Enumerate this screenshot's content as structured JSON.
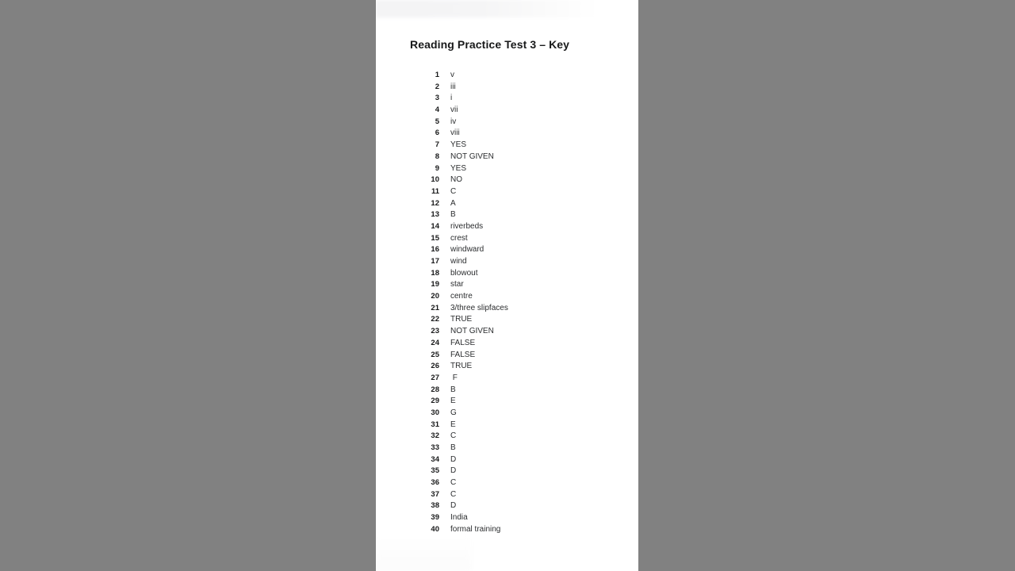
{
  "background": {
    "color": "#818181"
  },
  "document": {
    "page_background": "#ffffff",
    "title": "Reading Practice Test 3 – Key",
    "text_color": "#2b2d2f",
    "answers": [
      {
        "number": "1",
        "answer": "v"
      },
      {
        "number": "2",
        "answer": "iii"
      },
      {
        "number": "3",
        "answer": "i"
      },
      {
        "number": "4",
        "answer": "vii"
      },
      {
        "number": "5",
        "answer": "iv"
      },
      {
        "number": "6",
        "answer": "viii"
      },
      {
        "number": "7",
        "answer": "YES"
      },
      {
        "number": "8",
        "answer": "NOT GIVEN"
      },
      {
        "number": "9",
        "answer": "YES"
      },
      {
        "number": "10",
        "answer": "NO"
      },
      {
        "number": "11",
        "answer": "C"
      },
      {
        "number": "12",
        "answer": "A"
      },
      {
        "number": "13",
        "answer": "B"
      },
      {
        "number": "14",
        "answer": "riverbeds"
      },
      {
        "number": "15",
        "answer": "crest"
      },
      {
        "number": "16",
        "answer": "windward"
      },
      {
        "number": "17",
        "answer": "wind"
      },
      {
        "number": "18",
        "answer": "blowout"
      },
      {
        "number": "19",
        "answer": "star"
      },
      {
        "number": "20",
        "answer": "centre"
      },
      {
        "number": "21",
        "answer": "3/three slipfaces"
      },
      {
        "number": "22",
        "answer": "TRUE"
      },
      {
        "number": "23",
        "answer": "NOT GIVEN"
      },
      {
        "number": "24",
        "answer": "FALSE"
      },
      {
        "number": "25",
        "answer": "FALSE"
      },
      {
        "number": "26",
        "answer": "TRUE"
      },
      {
        "number": "27",
        "answer": " F"
      },
      {
        "number": "28",
        "answer": "B"
      },
      {
        "number": "29",
        "answer": "E"
      },
      {
        "number": "30",
        "answer": "G"
      },
      {
        "number": "31",
        "answer": "E"
      },
      {
        "number": "32",
        "answer": "C"
      },
      {
        "number": "33",
        "answer": "B"
      },
      {
        "number": "34",
        "answer": "D"
      },
      {
        "number": "35",
        "answer": "D"
      },
      {
        "number": "36",
        "answer": "C"
      },
      {
        "number": "37",
        "answer": "C"
      },
      {
        "number": "38",
        "answer": "D"
      },
      {
        "number": "39",
        "answer": "India"
      },
      {
        "number": "40",
        "answer": "formal training"
      }
    ]
  }
}
